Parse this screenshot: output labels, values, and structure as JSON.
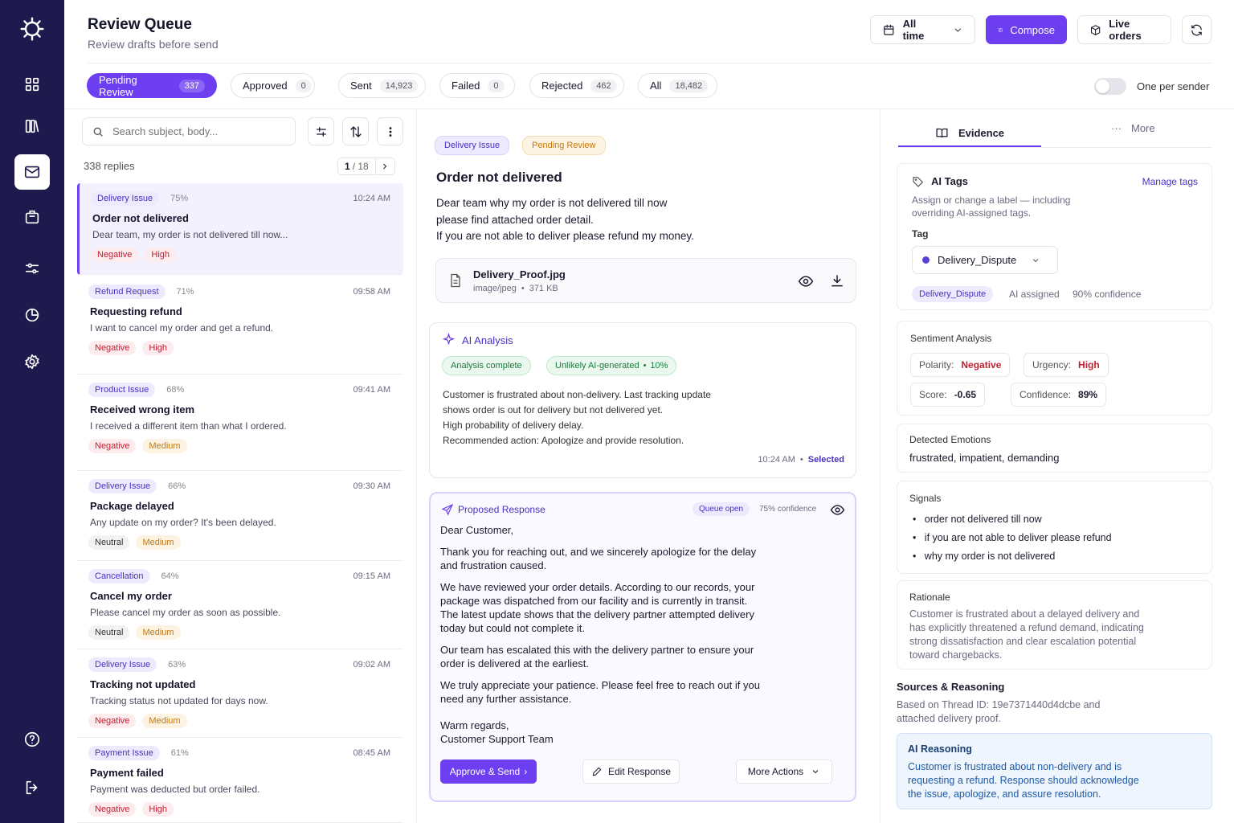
{
  "header": {
    "title": "Review Queue",
    "subtitle": "Review drafts before send",
    "date_filter": "All time",
    "compose_label": "Compose",
    "live_orders_label": "Live orders"
  },
  "tabs": [
    {
      "label": "Pending Review",
      "count": "337"
    },
    {
      "label": "Approved",
      "count": "0"
    },
    {
      "label": "Sent",
      "count": "14,923"
    },
    {
      "label": "Failed",
      "count": "0"
    },
    {
      "label": "Rejected",
      "count": "462"
    },
    {
      "label": "All",
      "count": "18,482"
    }
  ],
  "toggle_label": "One per sender",
  "search": {
    "placeholder": "Search subject, body..."
  },
  "list": {
    "count_label": "338 replies",
    "page": "1",
    "page_total": "/ 18",
    "items": [
      {
        "category": "Delivery Issue",
        "pct": "75%",
        "time": "10:24 AM",
        "title": "Order not delivered",
        "body": "Dear team, my order is not delivered till now...",
        "sentiment": "Negative",
        "urgency": "High"
      },
      {
        "category": "Refund Request",
        "pct": "71%",
        "time": "09:58 AM",
        "title": "Requesting refund",
        "body": "I want to cancel my order and get a refund.",
        "sentiment": "Negative",
        "urgency": "High"
      },
      {
        "category": "Product Issue",
        "pct": "68%",
        "time": "09:41 AM",
        "title": "Received wrong item",
        "body": "I received a different item than what I ordered.",
        "sentiment": "Negative",
        "urgency": "Medium"
      },
      {
        "category": "Delivery Issue",
        "pct": "66%",
        "time": "09:30 AM",
        "title": "Package delayed",
        "body": "Any update on my order? It's been delayed.",
        "sentiment": "Neutral",
        "urgency": "Medium"
      },
      {
        "category": "Cancellation",
        "pct": "64%",
        "time": "09:15 AM",
        "title": "Cancel my order",
        "body": "Please cancel my order as soon as possible.",
        "sentiment": "Neutral",
        "urgency": "Medium"
      },
      {
        "category": "Delivery Issue",
        "pct": "63%",
        "time": "09:02 AM",
        "title": "Tracking not updated",
        "body": "Tracking status not updated for days now.",
        "sentiment": "Negative",
        "urgency": "Medium"
      },
      {
        "category": "Payment Issue",
        "pct": "61%",
        "time": "08:45 AM",
        "title": "Payment failed",
        "body": "Payment was deducted but order failed.",
        "sentiment": "Negative",
        "urgency": "High"
      }
    ]
  },
  "detail": {
    "category_badge": "Delivery Issue",
    "status_badge": "Pending Review",
    "title": "Order not delivered",
    "body_lines": [
      "Dear team why my order is not delivered till now",
      "please find attached order detail.",
      "If you are not able to deliver please refund my money."
    ],
    "attachment": {
      "name": "Delivery_Proof.jpg",
      "type": "image/jpeg",
      "size": "371 KB"
    },
    "ai_analysis": {
      "title": "AI Analysis",
      "badge_complete": "Analysis complete",
      "badge_ai": "Unlikely AI-generated",
      "badge_ai_pct": "10%",
      "lines": [
        "Customer is frustrated about non-delivery. Last tracking update",
        "shows order is out for delivery but not delivered yet.",
        "High probability of delivery delay.",
        "Recommended action: Apologize and provide resolution."
      ],
      "time": "10:24 AM",
      "selected": "Selected"
    },
    "response": {
      "title": "Proposed Response",
      "queue_badge": "Queue open",
      "confidence": "75% confidence",
      "greeting": "Dear Customer,",
      "p1": [
        "Thank you for reaching out, and we sincerely apologize for the delay",
        "and frustration caused."
      ],
      "p2": [
        "We have reviewed your order details. According to our records, your",
        "package was dispatched from our facility and is currently in transit.",
        "The latest update shows that the delivery partner attempted delivery",
        "today but could not complete it."
      ],
      "p3": [
        "Our team has escalated this with the delivery partner to ensure your",
        "order is delivered at the earliest."
      ],
      "p4": [
        "We truly appreciate your patience. Please feel free to reach out if you",
        "need any further assistance."
      ],
      "signoff": [
        "Warm regards,",
        "Customer Support Team"
      ],
      "approve_label": "Approve & Send",
      "edit_label": "Edit Response",
      "more_label": "More Actions"
    }
  },
  "evidence": {
    "tab_label": "Evidence",
    "more_label": "More",
    "ai_tags": {
      "title": "AI Tags",
      "manage": "Manage tags",
      "desc": [
        "Assign or change a label — including",
        "overriding AI-assigned tags."
      ],
      "tag_label": "Tag",
      "selected_tag": "Delivery_Dispute",
      "chip": "Delivery_Dispute",
      "assigned": "AI assigned",
      "confidence": "90% confidence"
    },
    "sentiment": {
      "title": "Sentiment Analysis",
      "polarity_label": "Polarity:",
      "polarity": "Negative",
      "urgency_label": "Urgency:",
      "urgency": "High",
      "score_label": "Score:",
      "score": "-0.65",
      "confidence_label": "Confidence:",
      "confidence": "89%"
    },
    "emotions": {
      "title": "Detected Emotions",
      "value": "frustrated, impatient, demanding"
    },
    "signals": {
      "title": "Signals",
      "items": [
        "order not delivered till now",
        "if you are not able to deliver please refund",
        "why my order is not delivered"
      ]
    },
    "rationale": {
      "title": "Rationale",
      "lines": [
        "Customer is frustrated about a delayed delivery and",
        "has explicitly threatened a refund demand, indicating",
        "strong dissatisfaction and clear escalation potential",
        "toward chargebacks."
      ]
    },
    "sources": {
      "title": "Sources & Reasoning",
      "lines": [
        "Based on Thread ID: 19e7371440d4dcbe and",
        "attached delivery proof."
      ]
    },
    "reasoning": {
      "title": "AI Reasoning",
      "lines": [
        "Customer is frustrated about non-delivery and is",
        "requesting a refund. Response should acknowledge",
        "the issue, apologize, and assure resolution."
      ]
    }
  },
  "colors": {
    "sidebar": "#1f1a4d",
    "accent": "#6d3ff0",
    "negative": "#c21d30",
    "medium": "#c57a10"
  }
}
